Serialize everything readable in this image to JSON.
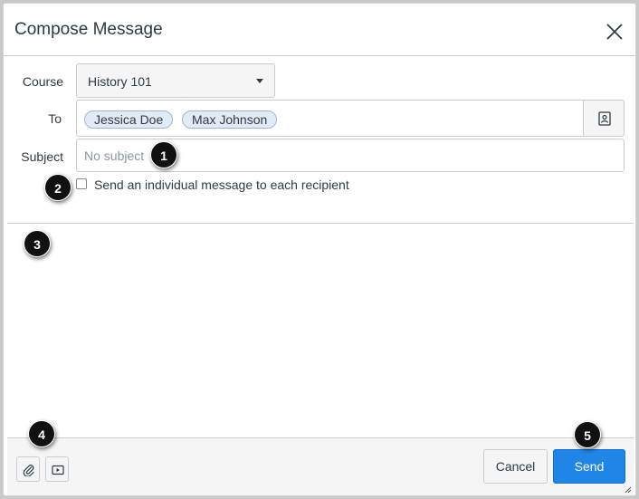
{
  "dialog": {
    "title": "Compose Message",
    "close_icon": "close-icon"
  },
  "form": {
    "course_label": "Course",
    "course_value": "History 101",
    "to_label": "To",
    "recipients": [
      "Jessica Doe",
      "Max Johnson"
    ],
    "address_book_icon": "address-book-icon",
    "subject_label": "Subject",
    "subject_placeholder": "No subject",
    "subject_value": "",
    "individual_label": "Send an individual message to each recipient",
    "individual_checked": false
  },
  "footer": {
    "attach_icon": "paperclip-icon",
    "media_icon": "media-icon",
    "cancel_label": "Cancel",
    "send_label": "Send"
  },
  "markers": [
    "1",
    "2",
    "3",
    "4",
    "5"
  ],
  "colors": {
    "primary": "#1f86e8",
    "token_bg": "#e0ebf5",
    "text": "#2d3b45"
  }
}
